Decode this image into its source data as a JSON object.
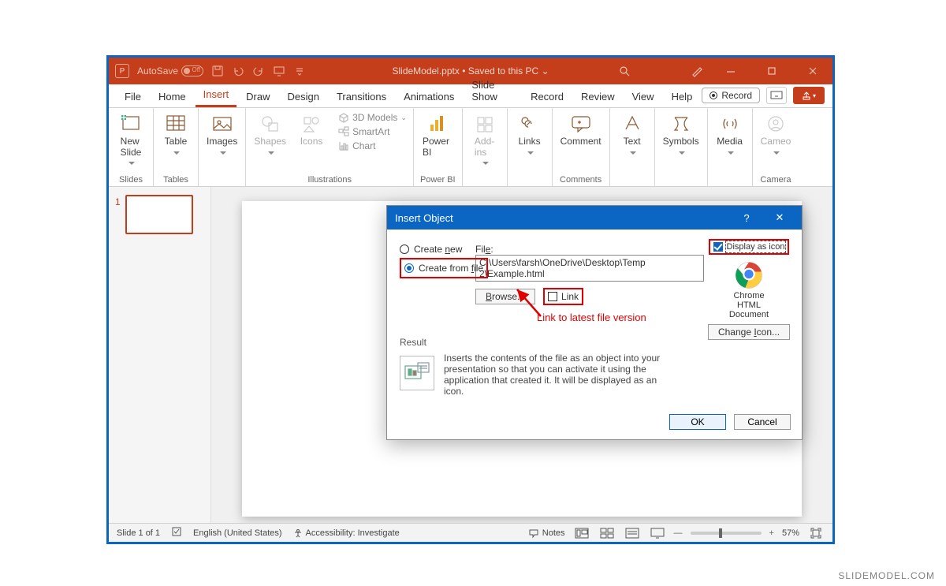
{
  "titlebar": {
    "autosave": "AutoSave",
    "filename": "SlideModel.pptx • Saved to this PC ⌄"
  },
  "tabs": [
    "File",
    "Home",
    "Insert",
    "Draw",
    "Design",
    "Transitions",
    "Animations",
    "Slide Show",
    "Record",
    "Review",
    "View",
    "Help"
  ],
  "active_tab": "Insert",
  "record_btn": "Record",
  "ribbon": {
    "slides": {
      "label": "Slides",
      "new_slide": "New\nSlide"
    },
    "tables": {
      "label": "Tables",
      "table": "Table"
    },
    "images": {
      "label": "",
      "images": "Images"
    },
    "illus": {
      "label": "Illustrations",
      "shapes": "Shapes",
      "icons": "Icons",
      "models": "3D Models",
      "smartart": "SmartArt",
      "chart": "Chart"
    },
    "powerbi": {
      "label": "Power BI",
      "btn": "Power\nBI"
    },
    "addins": {
      "label": "",
      "btn": "Add-\nins"
    },
    "links": {
      "label": "",
      "btn": "Links"
    },
    "comments": {
      "label": "Comments",
      "btn": "Comment"
    },
    "text": {
      "label": "",
      "btn": "Text"
    },
    "symbols": {
      "label": "",
      "btn": "Symbols"
    },
    "media": {
      "label": "",
      "btn": "Media"
    },
    "camera": {
      "label": "Camera",
      "btn": "Cameo"
    }
  },
  "thumb_number": "1",
  "dialog": {
    "title": "Insert Object",
    "create_new": "Create new",
    "create_from_file": "Create from file",
    "file_label": "File:",
    "file_value": "C:\\Users\\farsh\\OneDrive\\Desktop\\Temp 2\\Example.html",
    "browse": "Browse...",
    "link": "Link",
    "display_as_icon": "Display as icon",
    "chrome_label": "Chrome\nHTML\nDocument",
    "change_icon": "Change Icon...",
    "result": "Result",
    "result_text": "Inserts the contents of the file as an object into your presentation so that you can activate it using the application that created it. It will be displayed as an icon.",
    "ok": "OK",
    "cancel": "Cancel",
    "annotation": "Link to latest file version"
  },
  "status": {
    "slide": "Slide 1 of 1",
    "lang": "English (United States)",
    "access": "Accessibility: Investigate",
    "notes": "Notes",
    "zoom": "57%"
  },
  "watermark": "SLIDEMODEL.COM"
}
